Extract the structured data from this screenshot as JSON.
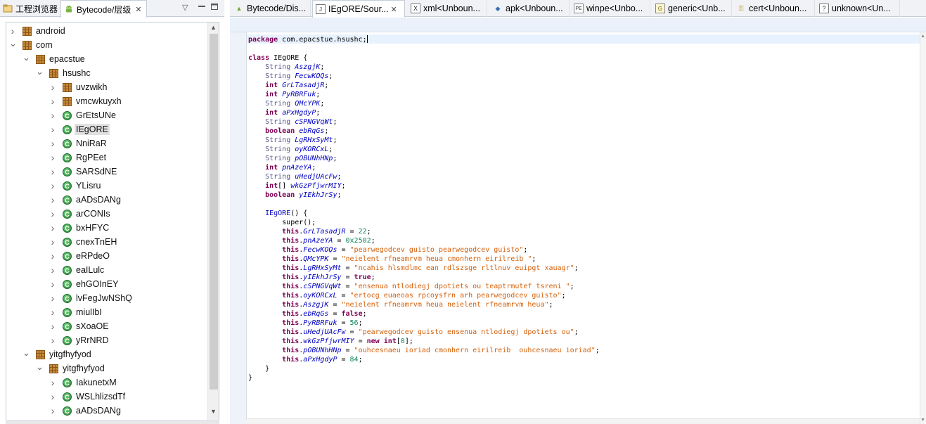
{
  "left_panel": {
    "tabs": [
      {
        "label": "工程浏览器",
        "icon": "project-explorer-icon"
      },
      {
        "label": "Bytecode/层级",
        "icon": "android-icon",
        "active": true
      }
    ],
    "tree": [
      {
        "label": "android",
        "type": "package",
        "depth": 0,
        "expanded": false
      },
      {
        "label": "com",
        "type": "package",
        "depth": 0,
        "expanded": true
      },
      {
        "label": "epacstue",
        "type": "package",
        "depth": 1,
        "expanded": true
      },
      {
        "label": "hsushc",
        "type": "package",
        "depth": 2,
        "expanded": true
      },
      {
        "label": "uvzwikh",
        "type": "package",
        "depth": 3,
        "expanded": false
      },
      {
        "label": "vmcwkuyxh",
        "type": "package",
        "depth": 3,
        "expanded": false
      },
      {
        "label": "GrEtsUNe",
        "type": "class",
        "depth": 3,
        "expanded": false
      },
      {
        "label": "IEgORE",
        "type": "class",
        "depth": 3,
        "expanded": false,
        "selected": true
      },
      {
        "label": "NniRaR",
        "type": "class",
        "depth": 3,
        "expanded": false
      },
      {
        "label": "RgPEet",
        "type": "class",
        "depth": 3,
        "expanded": false
      },
      {
        "label": "SARSdNE",
        "type": "class",
        "depth": 3,
        "expanded": false
      },
      {
        "label": "YLisru",
        "type": "class",
        "depth": 3,
        "expanded": false
      },
      {
        "label": "aADsDANg",
        "type": "class",
        "depth": 3,
        "expanded": false
      },
      {
        "label": "arCONIs",
        "type": "class",
        "depth": 3,
        "expanded": false
      },
      {
        "label": "bxHFYC",
        "type": "class",
        "depth": 3,
        "expanded": false
      },
      {
        "label": "cnexTnEH",
        "type": "class",
        "depth": 3,
        "expanded": false
      },
      {
        "label": "eRPdeO",
        "type": "class",
        "depth": 3,
        "expanded": false
      },
      {
        "label": "eaILulc",
        "type": "class",
        "depth": 3,
        "expanded": false
      },
      {
        "label": "ehGOInEY",
        "type": "class",
        "depth": 3,
        "expanded": false
      },
      {
        "label": "lvFegJwNShQ",
        "type": "class",
        "depth": 3,
        "expanded": false
      },
      {
        "label": "miulIbI",
        "type": "class",
        "depth": 3,
        "expanded": false
      },
      {
        "label": "sXoaOE",
        "type": "class",
        "depth": 3,
        "expanded": false
      },
      {
        "label": "yRrNRD",
        "type": "class",
        "depth": 3,
        "expanded": false
      },
      {
        "label": "yitgfhyfyod",
        "type": "package",
        "depth": 1,
        "expanded": true
      },
      {
        "label": "yitgfhyfyod",
        "type": "package",
        "depth": 2,
        "expanded": true
      },
      {
        "label": "IakunetxM",
        "type": "class",
        "depth": 3,
        "expanded": false
      },
      {
        "label": "WSLhlizsdTf",
        "type": "class",
        "depth": 3,
        "expanded": false
      },
      {
        "label": "aADsDANg",
        "type": "class",
        "depth": 3,
        "expanded": false
      }
    ]
  },
  "editor": {
    "tabs": [
      {
        "label": "Bytecode/Dis...",
        "icon": "android",
        "active": false
      },
      {
        "label": "IEgORE/Sour...",
        "icon": "doc",
        "active": true
      },
      {
        "label": "xml<Unboun...",
        "icon": "xml",
        "active": false
      },
      {
        "label": "apk<Unboun...",
        "icon": "apk",
        "active": false
      },
      {
        "label": "winpe<Unbo...",
        "icon": "pe",
        "active": false
      },
      {
        "label": "generic<Unb...",
        "icon": "gen",
        "active": false
      },
      {
        "label": "cert<Unboun...",
        "icon": "cert",
        "active": false
      },
      {
        "label": "unknown<Un...",
        "icon": "unk",
        "active": false
      }
    ],
    "code_lines": [
      [
        {
          "t": "kw",
          "s": "package"
        },
        {
          "t": "",
          "s": " com.epacstue.hsushc;"
        },
        {
          "t": "caret",
          "s": ""
        }
      ],
      [],
      [
        {
          "t": "kw",
          "s": "class"
        },
        {
          "t": "",
          "s": " IEgORE {"
        }
      ],
      [
        {
          "t": "",
          "s": "    "
        },
        {
          "t": "ty",
          "s": "String"
        },
        {
          "t": "",
          "s": " "
        },
        {
          "t": "fld",
          "s": "AszgjK"
        },
        {
          "t": "",
          "s": ";"
        }
      ],
      [
        {
          "t": "",
          "s": "    "
        },
        {
          "t": "ty",
          "s": "String"
        },
        {
          "t": "",
          "s": " "
        },
        {
          "t": "fld",
          "s": "FecwKOQs"
        },
        {
          "t": "",
          "s": ";"
        }
      ],
      [
        {
          "t": "",
          "s": "    "
        },
        {
          "t": "kw",
          "s": "int"
        },
        {
          "t": "",
          "s": " "
        },
        {
          "t": "fld",
          "s": "GrLTasadjR"
        },
        {
          "t": "",
          "s": ";"
        }
      ],
      [
        {
          "t": "",
          "s": "    "
        },
        {
          "t": "kw",
          "s": "int"
        },
        {
          "t": "",
          "s": " "
        },
        {
          "t": "fld",
          "s": "PyRBRFuk"
        },
        {
          "t": "",
          "s": ";"
        }
      ],
      [
        {
          "t": "",
          "s": "    "
        },
        {
          "t": "ty",
          "s": "String"
        },
        {
          "t": "",
          "s": " "
        },
        {
          "t": "fld",
          "s": "QMcYPK"
        },
        {
          "t": "",
          "s": ";"
        }
      ],
      [
        {
          "t": "",
          "s": "    "
        },
        {
          "t": "kw",
          "s": "int"
        },
        {
          "t": "",
          "s": " "
        },
        {
          "t": "fld",
          "s": "aPxHgdyP"
        },
        {
          "t": "",
          "s": ";"
        }
      ],
      [
        {
          "t": "",
          "s": "    "
        },
        {
          "t": "ty",
          "s": "String"
        },
        {
          "t": "",
          "s": " "
        },
        {
          "t": "fld",
          "s": "cSPNGVqWt"
        },
        {
          "t": "",
          "s": ";"
        }
      ],
      [
        {
          "t": "",
          "s": "    "
        },
        {
          "t": "kw",
          "s": "boolean"
        },
        {
          "t": "",
          "s": " "
        },
        {
          "t": "fld",
          "s": "ebRqGs"
        },
        {
          "t": "",
          "s": ";"
        }
      ],
      [
        {
          "t": "",
          "s": "    "
        },
        {
          "t": "ty",
          "s": "String"
        },
        {
          "t": "",
          "s": " "
        },
        {
          "t": "fld",
          "s": "LgRHxSyMt"
        },
        {
          "t": "",
          "s": ";"
        }
      ],
      [
        {
          "t": "",
          "s": "    "
        },
        {
          "t": "ty",
          "s": "String"
        },
        {
          "t": "",
          "s": " "
        },
        {
          "t": "fld",
          "s": "oyKORCxL"
        },
        {
          "t": "",
          "s": ";"
        }
      ],
      [
        {
          "t": "",
          "s": "    "
        },
        {
          "t": "ty",
          "s": "String"
        },
        {
          "t": "",
          "s": " "
        },
        {
          "t": "fld",
          "s": "pOBUNhHNp"
        },
        {
          "t": "",
          "s": ";"
        }
      ],
      [
        {
          "t": "",
          "s": "    "
        },
        {
          "t": "kw",
          "s": "int"
        },
        {
          "t": "",
          "s": " "
        },
        {
          "t": "fld",
          "s": "pnAzeYA"
        },
        {
          "t": "",
          "s": ";"
        }
      ],
      [
        {
          "t": "",
          "s": "    "
        },
        {
          "t": "ty",
          "s": "String"
        },
        {
          "t": "",
          "s": " "
        },
        {
          "t": "fld",
          "s": "uHedjUAcFw"
        },
        {
          "t": "",
          "s": ";"
        }
      ],
      [
        {
          "t": "",
          "s": "    "
        },
        {
          "t": "kw",
          "s": "int"
        },
        {
          "t": "",
          "s": "[] "
        },
        {
          "t": "fld",
          "s": "wkGzPfjwrMIY"
        },
        {
          "t": "",
          "s": ";"
        }
      ],
      [
        {
          "t": "",
          "s": "    "
        },
        {
          "t": "kw",
          "s": "boolean"
        },
        {
          "t": "",
          "s": " "
        },
        {
          "t": "fld",
          "s": "yIEkhJrSy"
        },
        {
          "t": "",
          "s": ";"
        }
      ],
      [],
      [
        {
          "t": "",
          "s": "    "
        },
        {
          "t": "fld2",
          "s": "IEgORE"
        },
        {
          "t": "",
          "s": "() {"
        }
      ],
      [
        {
          "t": "",
          "s": "        super();"
        }
      ],
      [
        {
          "t": "",
          "s": "        "
        },
        {
          "t": "kw",
          "s": "this"
        },
        {
          "t": "",
          "s": "."
        },
        {
          "t": "fld",
          "s": "GrLTasadjR"
        },
        {
          "t": "",
          "s": " = "
        },
        {
          "t": "num",
          "s": "22"
        },
        {
          "t": "",
          "s": ";"
        }
      ],
      [
        {
          "t": "",
          "s": "        "
        },
        {
          "t": "kw",
          "s": "this"
        },
        {
          "t": "",
          "s": "."
        },
        {
          "t": "fld",
          "s": "pnAzeYA"
        },
        {
          "t": "",
          "s": " = "
        },
        {
          "t": "num",
          "s": "0x2502"
        },
        {
          "t": "",
          "s": ";"
        }
      ],
      [
        {
          "t": "",
          "s": "        "
        },
        {
          "t": "kw",
          "s": "this"
        },
        {
          "t": "",
          "s": "."
        },
        {
          "t": "fld",
          "s": "FecwKOQs"
        },
        {
          "t": "",
          "s": " = "
        },
        {
          "t": "str",
          "s": "\"pearwegodcev guisto pearwegodcev guisto\""
        },
        {
          "t": "",
          "s": ";"
        }
      ],
      [
        {
          "t": "",
          "s": "        "
        },
        {
          "t": "kw",
          "s": "this"
        },
        {
          "t": "",
          "s": "."
        },
        {
          "t": "fld",
          "s": "QMcYPK"
        },
        {
          "t": "",
          "s": " = "
        },
        {
          "t": "str",
          "s": "\"neielent rfneamrvm heua cmonhern eirilreib \""
        },
        {
          "t": "",
          "s": ";"
        }
      ],
      [
        {
          "t": "",
          "s": "        "
        },
        {
          "t": "kw",
          "s": "this"
        },
        {
          "t": "",
          "s": "."
        },
        {
          "t": "fld",
          "s": "LgRHxSyMt"
        },
        {
          "t": "",
          "s": " = "
        },
        {
          "t": "str",
          "s": "\"ncahis hlsmdlmc ean rdlszsge rltlnuv euipgt xauagr\""
        },
        {
          "t": "",
          "s": ";"
        }
      ],
      [
        {
          "t": "",
          "s": "        "
        },
        {
          "t": "kw",
          "s": "this"
        },
        {
          "t": "",
          "s": "."
        },
        {
          "t": "fld",
          "s": "yIEkhJrSy"
        },
        {
          "t": "",
          "s": " = "
        },
        {
          "t": "kw",
          "s": "true"
        },
        {
          "t": "",
          "s": ";"
        }
      ],
      [
        {
          "t": "",
          "s": "        "
        },
        {
          "t": "kw",
          "s": "this"
        },
        {
          "t": "",
          "s": "."
        },
        {
          "t": "fld",
          "s": "cSPNGVqWt"
        },
        {
          "t": "",
          "s": " = "
        },
        {
          "t": "str",
          "s": "\"ensenua ntlodiegj dpotiets ou teaptrmutef tsreni \""
        },
        {
          "t": "",
          "s": ";"
        }
      ],
      [
        {
          "t": "",
          "s": "        "
        },
        {
          "t": "kw",
          "s": "this"
        },
        {
          "t": "",
          "s": "."
        },
        {
          "t": "fld",
          "s": "oyKORCxL"
        },
        {
          "t": "",
          "s": " = "
        },
        {
          "t": "str",
          "s": "\"ertocg euaeoas rpcoysfrn arh pearwegodcev guisto\""
        },
        {
          "t": "",
          "s": ";"
        }
      ],
      [
        {
          "t": "",
          "s": "        "
        },
        {
          "t": "kw",
          "s": "this"
        },
        {
          "t": "",
          "s": "."
        },
        {
          "t": "fld",
          "s": "AszgjK"
        },
        {
          "t": "",
          "s": " = "
        },
        {
          "t": "str",
          "s": "\"neielent rfneamrvm heua neielent rfneamrvm heua\""
        },
        {
          "t": "",
          "s": ";"
        }
      ],
      [
        {
          "t": "",
          "s": "        "
        },
        {
          "t": "kw",
          "s": "this"
        },
        {
          "t": "",
          "s": "."
        },
        {
          "t": "fld",
          "s": "ebRqGs"
        },
        {
          "t": "",
          "s": " = "
        },
        {
          "t": "kw",
          "s": "false"
        },
        {
          "t": "",
          "s": ";"
        }
      ],
      [
        {
          "t": "",
          "s": "        "
        },
        {
          "t": "kw",
          "s": "this"
        },
        {
          "t": "",
          "s": "."
        },
        {
          "t": "fld",
          "s": "PyRBRFuk"
        },
        {
          "t": "",
          "s": " = "
        },
        {
          "t": "num",
          "s": "56"
        },
        {
          "t": "",
          "s": ";"
        }
      ],
      [
        {
          "t": "",
          "s": "        "
        },
        {
          "t": "kw",
          "s": "this"
        },
        {
          "t": "",
          "s": "."
        },
        {
          "t": "fld",
          "s": "uHedjUAcFw"
        },
        {
          "t": "",
          "s": " = "
        },
        {
          "t": "str",
          "s": "\"pearwegodcev guisto ensenua ntlodiegj dpotiets ou\""
        },
        {
          "t": "",
          "s": ";"
        }
      ],
      [
        {
          "t": "",
          "s": "        "
        },
        {
          "t": "kw",
          "s": "this"
        },
        {
          "t": "",
          "s": "."
        },
        {
          "t": "fld",
          "s": "wkGzPfjwrMIY"
        },
        {
          "t": "",
          "s": " = "
        },
        {
          "t": "kw",
          "s": "new"
        },
        {
          "t": "",
          "s": " "
        },
        {
          "t": "kw",
          "s": "int"
        },
        {
          "t": "",
          "s": "["
        },
        {
          "t": "num",
          "s": "0"
        },
        {
          "t": "",
          "s": "];"
        }
      ],
      [
        {
          "t": "",
          "s": "        "
        },
        {
          "t": "kw",
          "s": "this"
        },
        {
          "t": "",
          "s": "."
        },
        {
          "t": "fld",
          "s": "pOBUNhHNp"
        },
        {
          "t": "",
          "s": " = "
        },
        {
          "t": "str",
          "s": "\"ouhcesnaeu ioriad cmonhern eirilreib  ouhcesnaeu ioriad\""
        },
        {
          "t": "",
          "s": ";"
        }
      ],
      [
        {
          "t": "",
          "s": "        "
        },
        {
          "t": "kw",
          "s": "this"
        },
        {
          "t": "",
          "s": "."
        },
        {
          "t": "fld",
          "s": "aPxHgdyP"
        },
        {
          "t": "",
          "s": " = "
        },
        {
          "t": "num",
          "s": "84"
        },
        {
          "t": "",
          "s": ";"
        }
      ],
      [
        {
          "t": "",
          "s": "    }"
        }
      ],
      [
        {
          "t": "",
          "s": "}"
        }
      ]
    ]
  },
  "colors": {
    "keyword": "#7f0055",
    "string": "#d4600a",
    "number": "#098658",
    "field": "#0000c0",
    "tab_bar": "#f0f2f5",
    "selection": "#e1e1e1"
  }
}
